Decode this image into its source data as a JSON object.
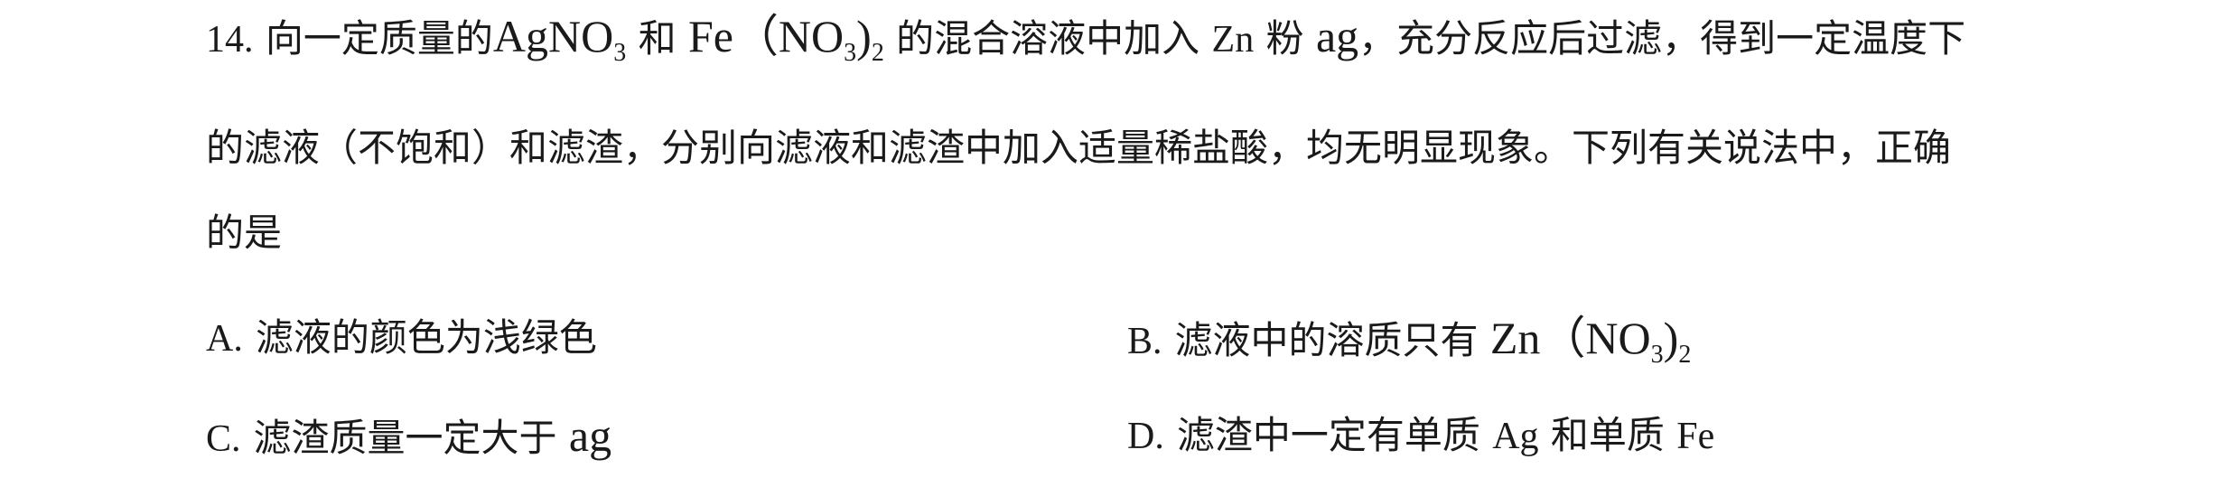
{
  "question": {
    "number": "14.",
    "line1": {
      "p1": "向一定质量的",
      "agno3_main": "AgNO",
      "agno3_sub": "3",
      "p2": "和",
      "fe": "Fe",
      "paren_open": "（NO",
      "no3_sub": "3",
      "paren_close": ")",
      "outer_sub": "2",
      "p3": "的混合溶液中加入",
      "zn": "Zn",
      "p4": "粉",
      "ag_mass": "ag",
      "p5": "，充分反应后过滤，得到一定温度下"
    },
    "line2": "的滤液（不饱和）和滤渣，分别向滤液和滤渣中加入适量稀盐酸，均无明显现象。下列有关说法中，正确",
    "line3": "的是"
  },
  "options": {
    "a": {
      "letter": "A.",
      "text": "滤液的颜色为浅绿色"
    },
    "b": {
      "letter": "B.",
      "text_pre": "滤液中的溶质只有",
      "zn": "Zn",
      "paren_open": "（NO",
      "no3_sub": "3",
      "paren_close": ")",
      "outer_sub": "2"
    },
    "c": {
      "letter": "C.",
      "text_pre": "滤渣质量一定大于",
      "ag_mass": "ag"
    },
    "d": {
      "letter": "D.",
      "text_pre": "滤渣中一定有单质",
      "ag": "Ag",
      "mid": "和单质",
      "fe": "Fe"
    }
  }
}
